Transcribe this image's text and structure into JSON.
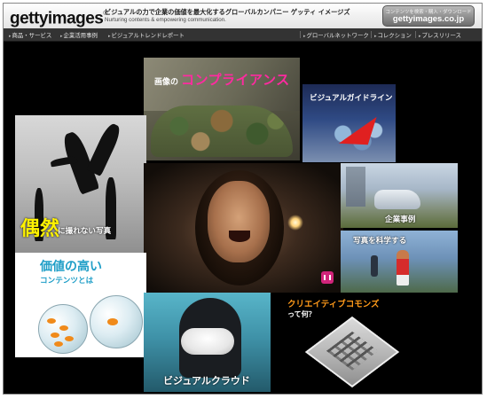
{
  "header": {
    "logo_text": "gettyimages",
    "logo_mark": "®",
    "tagline_jp": "ビジュアルの力で企業の価値を最大化するグローバルカンパニー ゲッティ イメージズ",
    "tagline_en": "Nurturing contents & empowering communication.",
    "site_button": {
      "small_text": "コンテンツを検索・購入・ダウンロード",
      "domain": "gettyimages.co.jp"
    }
  },
  "nav": {
    "left": [
      "商品・サービス",
      "企業活用事例",
      "ビジュアルトレンドレポート"
    ],
    "right": [
      "グローバルネットワーク",
      "コレクション",
      "プレスリリース"
    ]
  },
  "panels": {
    "compliance": {
      "prefix": "画像の",
      "title": "コンプライアンス"
    },
    "guideline": {
      "title": "ビジュアルガイドライン"
    },
    "chance": {
      "big": "偶然",
      "rest": "に撮れない写真"
    },
    "corporate": {
      "title": "企業事例"
    },
    "science": {
      "title": "写真を科学する"
    },
    "contents": {
      "line1": "価値の高い",
      "line2": "コンテンツとは"
    },
    "cloud": {
      "title": "ビジュアルクラウド"
    },
    "creative_commons": {
      "line1": "クリエイティブコモンズ",
      "line2": "って何？"
    }
  },
  "colors": {
    "background": "#000000",
    "compliance_accent": "#ff2aa0",
    "chance_accent": "#fff200",
    "contents_accent": "#1f9ec7",
    "cc_accent": "#ff9a1a"
  }
}
